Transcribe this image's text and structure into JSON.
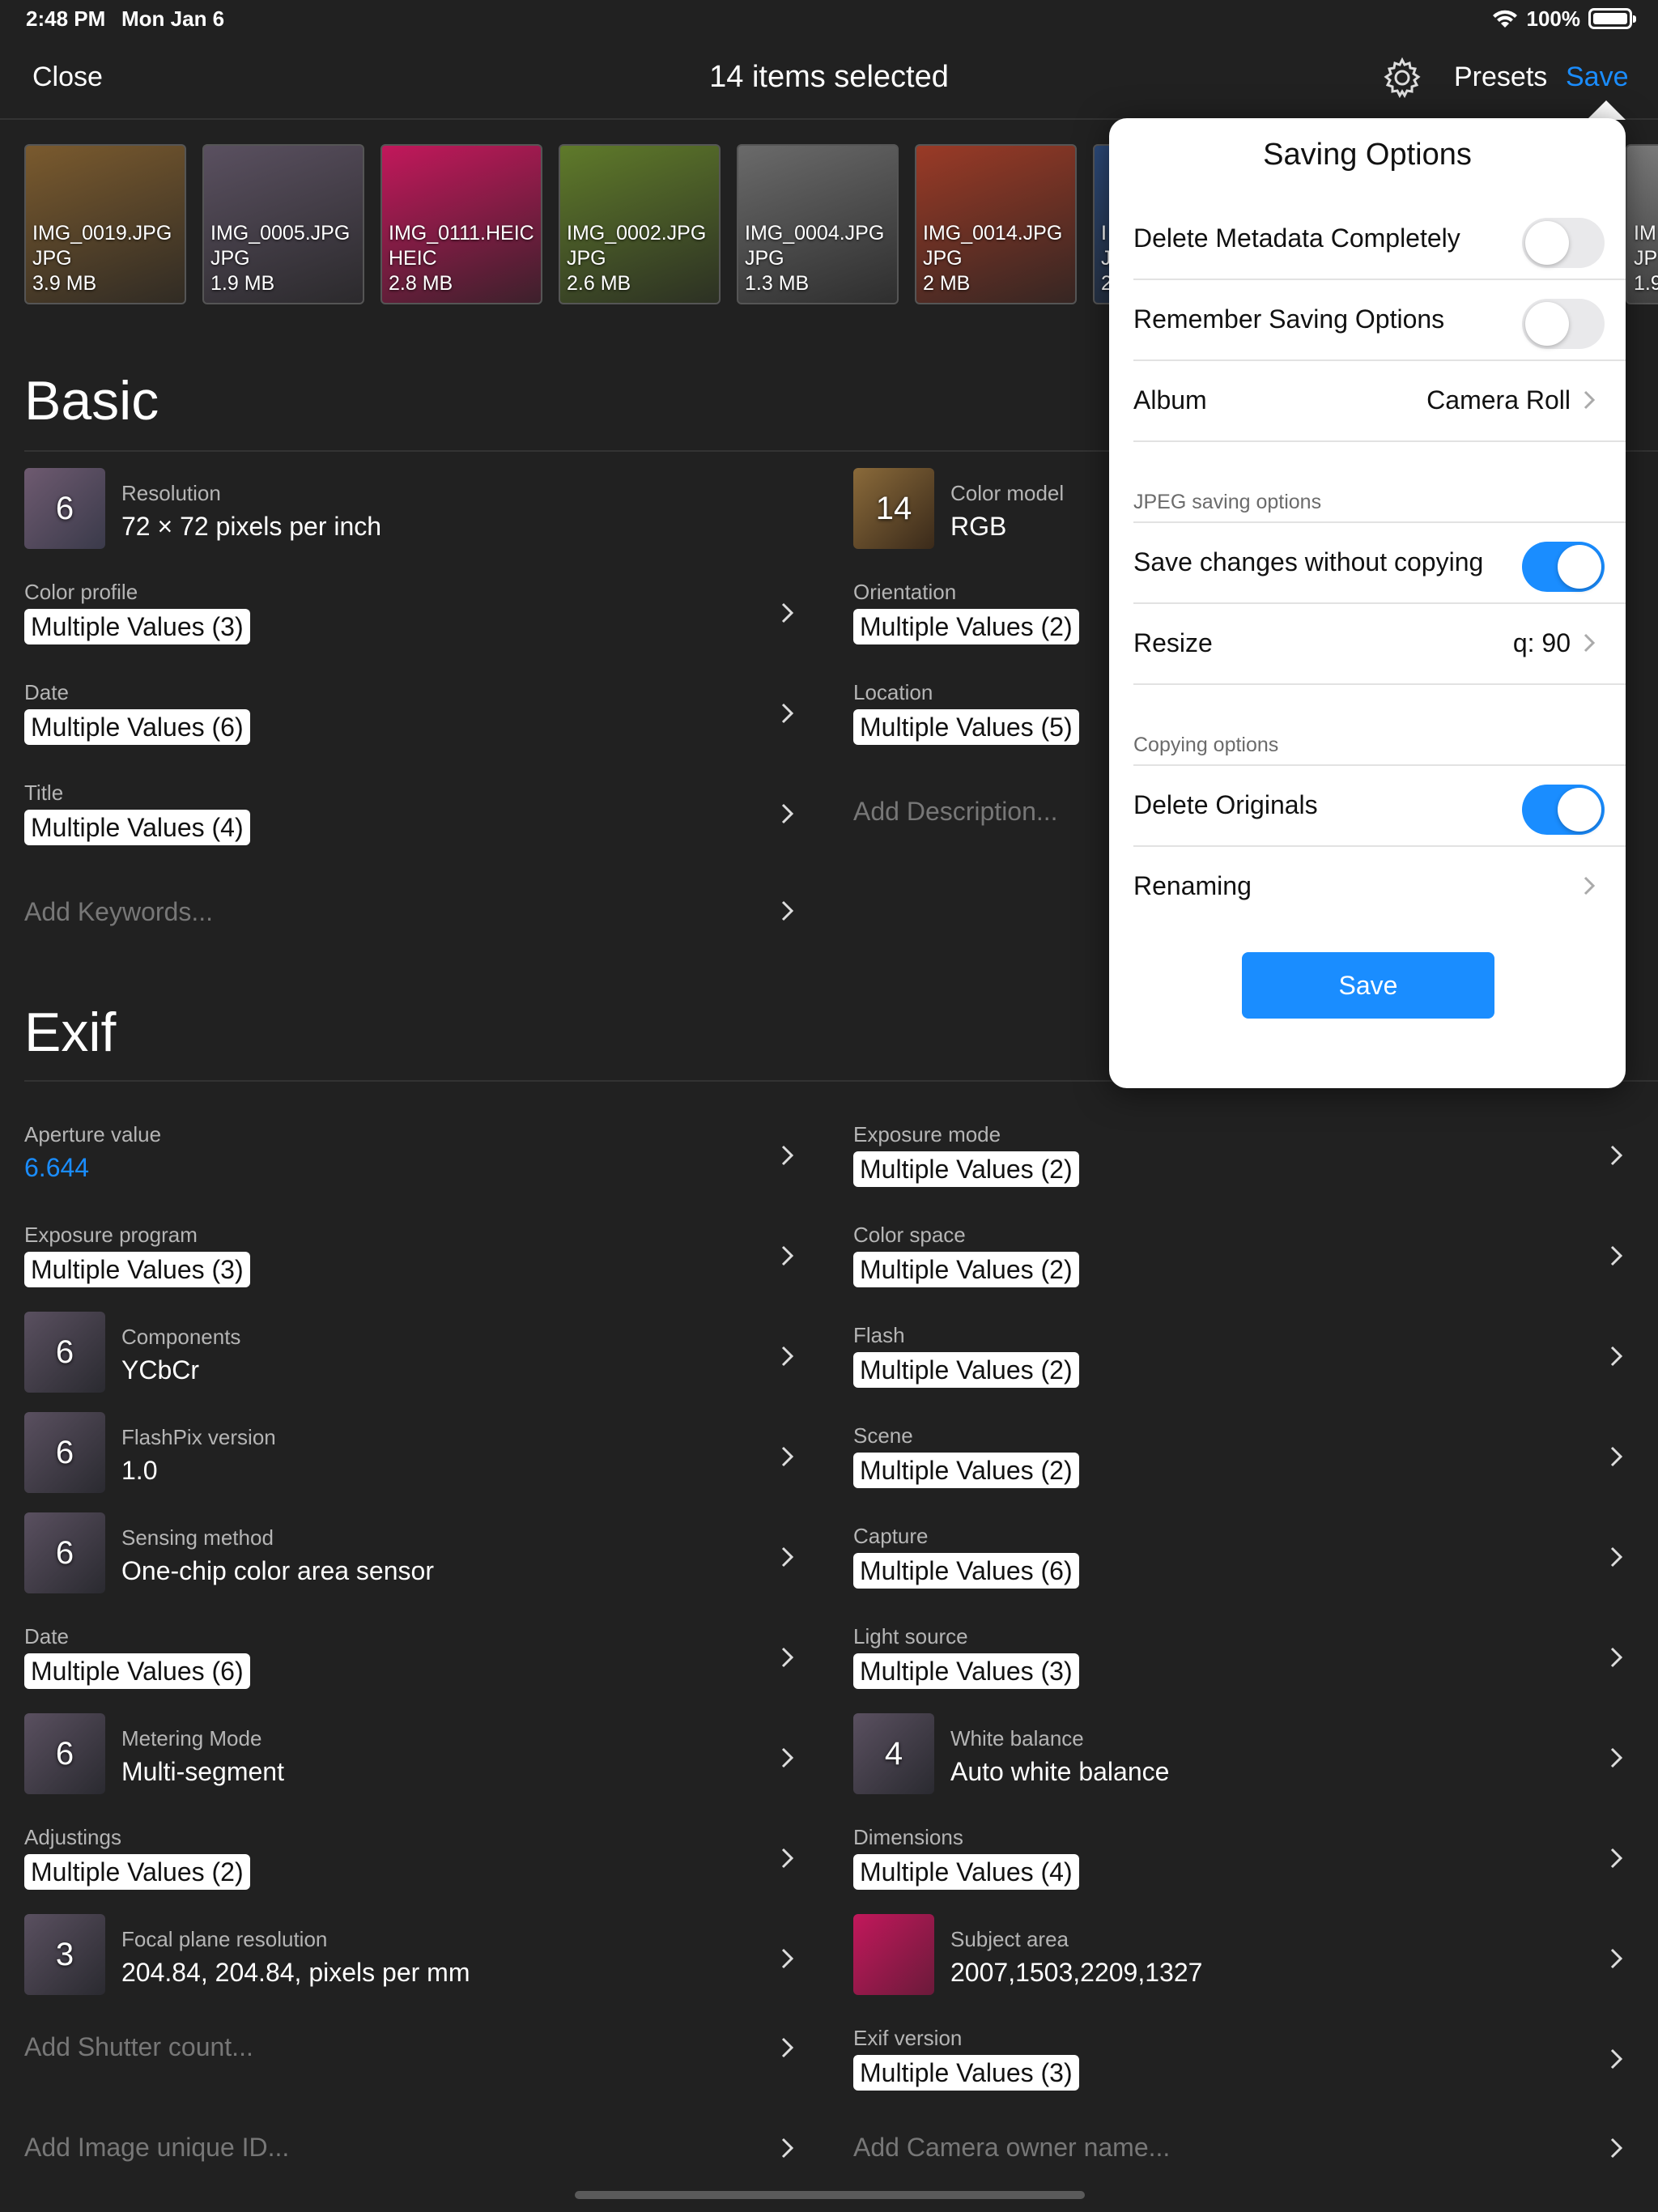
{
  "status": {
    "time": "2:48 PM",
    "date": "Mon Jan 6",
    "battery": "100%"
  },
  "nav": {
    "close": "Close",
    "title": "14 items selected",
    "presets": "Presets",
    "save": "Save"
  },
  "thumbnails": [
    {
      "name": "IMG_0019.JPG",
      "type": "JPG",
      "size": "3.9 MB",
      "color": "#7a5a2e"
    },
    {
      "name": "IMG_0005.JPG",
      "type": "JPG",
      "size": "1.9 MB",
      "color": "#5a5060"
    },
    {
      "name": "IMG_0111.HEIC",
      "type": "HEIC",
      "size": "2.8 MB",
      "color": "#c2185b"
    },
    {
      "name": "IMG_0002.JPG",
      "type": "JPG",
      "size": "2.6 MB",
      "color": "#5f7a2a"
    },
    {
      "name": "IMG_0004.JPG",
      "type": "JPG",
      "size": "1.3 MB",
      "color": "#6a6a6a"
    },
    {
      "name": "IMG_0014.JPG",
      "type": "JPG",
      "size": "2 MB",
      "color": "#9a3a26"
    },
    {
      "name": "I",
      "type": "J",
      "size": "2",
      "color": "#2c4a7a"
    },
    {
      "name": "IM",
      "type": "JP",
      "size": "1.9",
      "color": "#7d7d7d"
    }
  ],
  "basic": {
    "title": "Basic",
    "resolution": {
      "badge": "6",
      "label": "Resolution",
      "value": "72 × 72 pixels per inch"
    },
    "color_model": {
      "badge": "14",
      "label": "Color model",
      "value": "RGB"
    },
    "color_profile": {
      "label": "Color profile",
      "value": "Multiple Values (3)"
    },
    "orientation": {
      "label": "Orientation",
      "value": "Multiple Values (2)"
    },
    "date": {
      "label": "Date",
      "value": "Multiple Values (6)"
    },
    "location": {
      "label": "Location",
      "value": "Multiple Values (5)"
    },
    "title_field": {
      "label": "Title",
      "value": "Multiple Values (4)"
    },
    "add_description": "Add Description...",
    "add_keywords": "Add Keywords..."
  },
  "exif": {
    "title": "Exif",
    "aperture": {
      "label": "Aperture value",
      "value": "6.644"
    },
    "exposure_mode": {
      "label": "Exposure mode",
      "value": "Multiple Values (2)"
    },
    "exposure_program": {
      "label": "Exposure program",
      "value": "Multiple Values (3)"
    },
    "color_space": {
      "label": "Color space",
      "value": "Multiple Values (2)"
    },
    "components": {
      "badge": "6",
      "label": "Components",
      "value": "YCbCr"
    },
    "flash": {
      "label": "Flash",
      "value": "Multiple Values (2)"
    },
    "flashpix": {
      "badge": "6",
      "label": "FlashPix version",
      "value": "1.0"
    },
    "scene": {
      "label": "Scene",
      "value": "Multiple Values (2)"
    },
    "sensing": {
      "badge": "6",
      "label": "Sensing method",
      "value": "One-chip color area sensor"
    },
    "capture": {
      "label": "Capture",
      "value": "Multiple Values (6)"
    },
    "date": {
      "label": "Date",
      "value": "Multiple Values (6)"
    },
    "light_source": {
      "label": "Light source",
      "value": "Multiple Values (3)"
    },
    "metering": {
      "badge": "6",
      "label": "Metering Mode",
      "value": "Multi-segment"
    },
    "white_balance": {
      "badge": "4",
      "label": "White balance",
      "value": "Auto white balance"
    },
    "adjustings": {
      "label": "Adjustings",
      "value": "Multiple Values (2)"
    },
    "dimensions": {
      "label": "Dimensions",
      "value": "Multiple Values (4)"
    },
    "focal_plane": {
      "badge": "3",
      "label": "Focal plane resolution",
      "value": "204.84, 204.84, pixels per mm"
    },
    "subject_area": {
      "label": "Subject area",
      "value": "2007,1503,2209,1327"
    },
    "add_shutter": "Add Shutter count...",
    "exif_version": {
      "label": "Exif version",
      "value": "Multiple Values (3)"
    },
    "add_image_id": "Add Image unique ID...",
    "add_owner": "Add Camera owner name..."
  },
  "popover": {
    "title": "Saving Options",
    "delete_metadata": {
      "label": "Delete Metadata Completely",
      "on": false
    },
    "remember": {
      "label": "Remember Saving Options",
      "on": false
    },
    "album": {
      "label": "Album",
      "value": "Camera Roll"
    },
    "jpeg_section": "JPEG saving options",
    "save_without_copy": {
      "label": "Save changes without copying",
      "on": true
    },
    "resize": {
      "label": "Resize",
      "value": "q: 90"
    },
    "copy_section": "Copying options",
    "delete_originals": {
      "label": "Delete Originals",
      "on": true
    },
    "renaming": {
      "label": "Renaming"
    },
    "save_button": "Save"
  },
  "colors": {
    "accent": "#1a8dff",
    "background": "#212121",
    "popover": "#ffffff"
  }
}
